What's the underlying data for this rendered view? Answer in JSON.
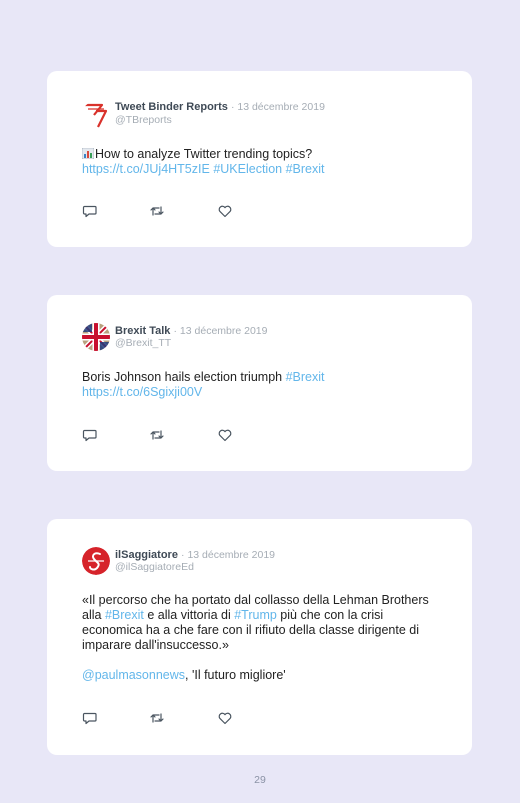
{
  "colors": {
    "background": "#e8e7f7",
    "card": "#ffffff",
    "link": "#62b6ea",
    "name": "#3f4a56",
    "muted": "#a6adb5"
  },
  "tweets": [
    {
      "name": "Tweet Binder Reports",
      "date": "· 13 décembre 2019",
      "handle": "@TBreports",
      "avatar_icon": "tweet-binder-logo",
      "emoji_icon": "bar-chart-emoji",
      "text": "How to analyze Twitter trending topics?",
      "url": "https://t.co/JUj4HT5zIE",
      "hashtag1": "#UKElection",
      "hashtag2": "#Brexit"
    },
    {
      "name": "Brexit Talk",
      "date": "· 13 décembre 2019",
      "handle": "@Brexit_TT",
      "avatar_icon": "union-jack-avatar",
      "text": "Boris Johnson hails election triumph",
      "hashtag": "#Brexit",
      "url": "https://t.co/6Sgixji00V"
    },
    {
      "name": "ilSaggiatore",
      "date": "· 13 décembre 2019",
      "handle": "@ilSaggiatoreEd",
      "avatar_icon": "il-saggiatore-logo",
      "text_a": "«Il percorso che ha portato dal collasso della Lehman Brothers alla",
      "hashtag1": "#Brexit",
      "text_b": "e alla vittoria di",
      "hashtag2": "#Trump",
      "text_c": "più che con la crisi economica ha a che fare con il rifiuto della classe dirigente di imparare dall'insuccesso.»",
      "mention": "@paulmasonnews",
      "text_d": ", 'Il futuro migliore'"
    }
  ],
  "actions": {
    "reply_icon": "reply-icon",
    "retweet_icon": "retweet-icon",
    "like_icon": "heart-icon"
  },
  "page_number": "29"
}
